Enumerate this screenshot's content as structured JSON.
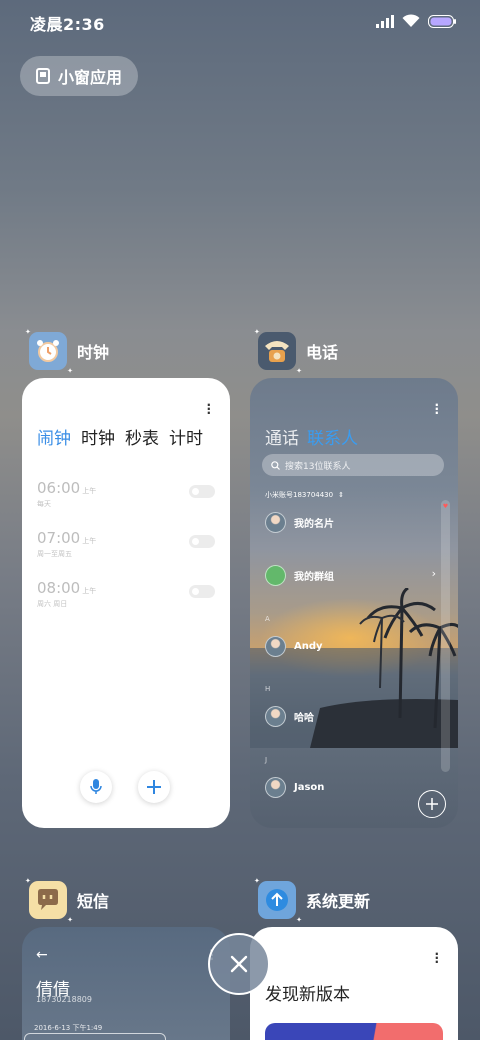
{
  "status": {
    "time": "凌晨2:36"
  },
  "mini_window": {
    "label": "小窗应用"
  },
  "apps": {
    "clock": {
      "name": "时钟",
      "tabs": [
        "闹钟",
        "时钟",
        "秒表",
        "计时"
      ],
      "alarms": [
        {
          "time": "06:00",
          "ampm": "上午",
          "repeat": "每天"
        },
        {
          "time": "07:00",
          "ampm": "上午",
          "repeat": "周一至周五"
        },
        {
          "time": "08:00",
          "ampm": "上午",
          "repeat": "周六 周日"
        }
      ]
    },
    "phone": {
      "name": "电话",
      "tabs": [
        "通话",
        "联系人"
      ],
      "search_placeholder": "搜索13位联系人",
      "account": "小米账号183704430",
      "contacts": [
        {
          "name": "我的名片"
        },
        {
          "name": "我的群组"
        },
        {
          "letter": "A",
          "name": "Andy"
        },
        {
          "letter": "H",
          "name": "哈哈"
        },
        {
          "letter": "J",
          "name": "Jason"
        }
      ]
    },
    "sms": {
      "name": "短信",
      "contact_name": "倩倩",
      "contact_number": "18730218809",
      "timestamp": "2016-6-13 下午1:49"
    },
    "update": {
      "name": "系统更新",
      "headline": "发现新版本"
    }
  },
  "colors": {
    "accent": "#3a8ee6",
    "clock_icon": "#7fa9d6",
    "sms_icon": "#f5dfa6",
    "update_icon": "#6fa5dc"
  }
}
